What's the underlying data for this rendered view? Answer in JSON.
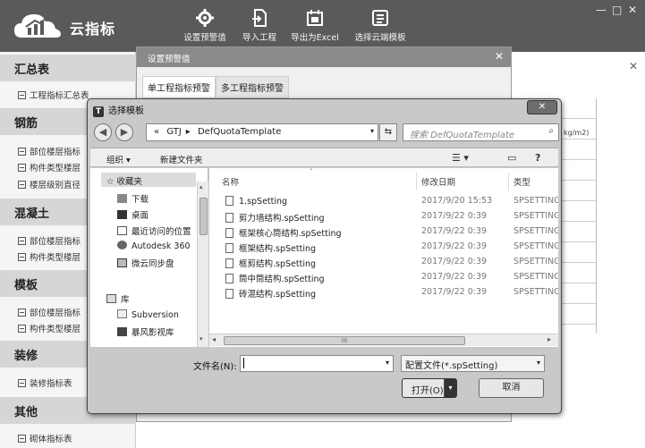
{
  "app": {
    "name": "云指标",
    "toolbar": [
      {
        "label": "设置预警值",
        "icon": "gear-icon"
      },
      {
        "label": "导入工程",
        "icon": "import-icon"
      },
      {
        "label": "导出为Excel",
        "icon": "export-excel-icon"
      },
      {
        "label": "选择云端模板",
        "icon": "template-icon"
      }
    ],
    "window_controls": [
      "—",
      "□",
      "✕"
    ]
  },
  "sidebar": {
    "sections": [
      {
        "title": "汇总表",
        "items": [
          "工程指标汇总表"
        ]
      },
      {
        "title": "钢筋",
        "items": [
          "部位楼层指标",
          "构件类型楼层",
          "楼层级别直径"
        ]
      },
      {
        "title": "混凝土",
        "items": [
          "部位楼层指标",
          "构件类型楼层"
        ]
      },
      {
        "title": "模板",
        "items": [
          "部位楼层指标",
          "构件类型楼层"
        ]
      },
      {
        "title": "装修",
        "items": [
          "装修指标表"
        ]
      },
      {
        "title": "其他",
        "items": [
          "砌体指标表"
        ]
      }
    ]
  },
  "background": {
    "unit_text": "kg/m2)",
    "close_symbol": "✕"
  },
  "warning_dialog": {
    "title": "设置预警值",
    "close_symbol": "✕",
    "tabs": [
      "单工程指标预警",
      "多工程指标预警"
    ]
  },
  "file_dialog": {
    "title": "选择模板",
    "title_icon": "T",
    "close_symbol": "✕",
    "back_symbol": "◀",
    "forward_symbol": "▶",
    "path": {
      "prefix": "«",
      "segments": [
        "GTJ",
        "DefQuotaTemplate"
      ],
      "separator": "▸",
      "dropdown": "▾"
    },
    "refresh_symbol": "⇆",
    "search_placeholder": "搜索 DefQuotaTemplate",
    "search_symbol": "⌕",
    "commands": {
      "organize": "组织 ▾",
      "new_folder": "新建文件夹",
      "view_symbol": "☰ ▾",
      "pane_symbol": "▭",
      "help_symbol": "?"
    },
    "nav": {
      "favorites_label": "收藏夹",
      "favorites": [
        "下载",
        "桌面",
        "最近访问的位置",
        "Autodesk 360",
        "微云同步盘"
      ],
      "library_label": "库",
      "libraries": [
        "Subversion",
        "暴风影视库"
      ]
    },
    "columns": {
      "name": "名称",
      "date": "修改日期",
      "type": "类型",
      "sort_symbol": "ˆ"
    },
    "files": [
      {
        "name": "1.spSetting",
        "date": "2017/9/20 15:53",
        "type": "SPSETTING"
      },
      {
        "name": "剪力墙结构.spSetting",
        "date": "2017/9/22 0:39",
        "type": "SPSETTING"
      },
      {
        "name": "框架核心筒结构.spSetting",
        "date": "2017/9/22 0:39",
        "type": "SPSETTING"
      },
      {
        "name": "框架结构.spSetting",
        "date": "2017/9/22 0:39",
        "type": "SPSETTING"
      },
      {
        "name": "框剪结构.spSetting",
        "date": "2017/9/22 0:39",
        "type": "SPSETTING"
      },
      {
        "name": "筒中筒结构.spSetting",
        "date": "2017/9/22 0:39",
        "type": "SPSETTING"
      },
      {
        "name": "砖混结构.spSetting",
        "date": "2017/9/22 0:39",
        "type": "SPSETTING"
      }
    ],
    "scrollbar": {
      "left_arrow": "◂",
      "right_arrow": "▸",
      "up_arrow": "▴",
      "down_arrow": "▾",
      "grip": "III"
    },
    "filename_label": "文件名(N):",
    "filename_value": "",
    "filetype_value": "配置文件(*.spSetting)",
    "dropdown_symbol": "▾",
    "open_label": "打开(O)",
    "open_split_symbol": "▾",
    "cancel_label": "取消"
  }
}
